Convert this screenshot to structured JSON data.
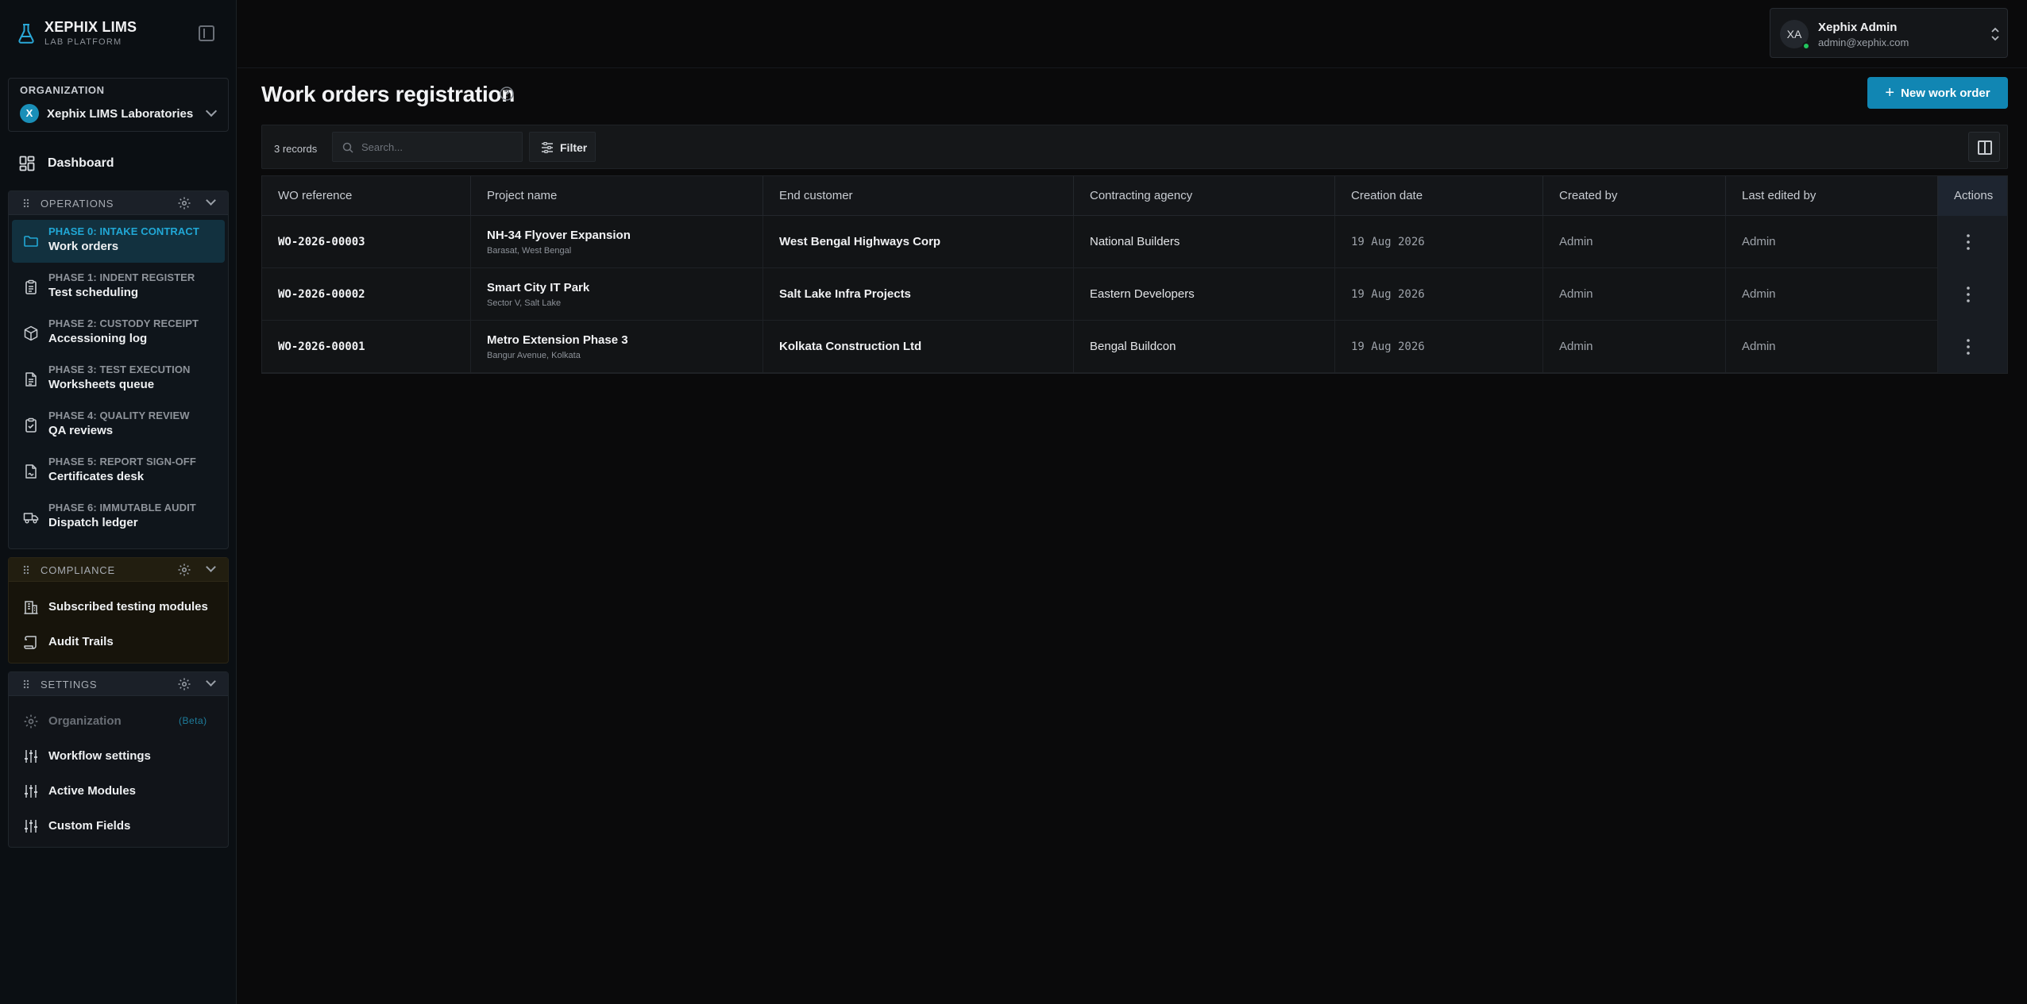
{
  "brand": {
    "title": "XEPHIX LIMS",
    "subtitle": "LAB PLATFORM"
  },
  "organization": {
    "label": "ORGANIZATION",
    "badge": "X",
    "name": "Xephix LIMS Laboratories"
  },
  "dashboard": {
    "label": "Dashboard"
  },
  "sections": {
    "operations": {
      "title": "OPERATIONS",
      "items": [
        {
          "phase": "PHASE 0: INTAKE CONTRACT",
          "label": "Work orders",
          "icon": "folder-icon"
        },
        {
          "phase": "PHASE 1: INDENT REGISTER",
          "label": "Test scheduling",
          "icon": "clipboard-icon"
        },
        {
          "phase": "PHASE 2: CUSTODY RECEIPT",
          "label": "Accessioning log",
          "icon": "package-icon"
        },
        {
          "phase": "PHASE 3: TEST EXECUTION",
          "label": "Worksheets queue",
          "icon": "file-text-icon"
        },
        {
          "phase": "PHASE 4: QUALITY REVIEW",
          "label": "QA reviews",
          "icon": "clipboard-check-icon"
        },
        {
          "phase": "PHASE 5: REPORT SIGN-OFF",
          "label": "Certificates desk",
          "icon": "file-signature-icon"
        },
        {
          "phase": "PHASE 6: IMMUTABLE AUDIT",
          "label": "Dispatch ledger",
          "icon": "truck-icon"
        }
      ]
    },
    "compliance": {
      "title": "COMPLIANCE",
      "items": [
        {
          "label": "Subscribed testing modules",
          "icon": "building-icon"
        },
        {
          "label": "Audit Trails",
          "icon": "scroll-icon"
        }
      ]
    },
    "settings": {
      "title": "SETTINGS",
      "items": [
        {
          "label": "Organization",
          "badge": "(Beta)",
          "icon": "gear-icon"
        },
        {
          "label": "Workflow settings",
          "icon": "sliders-icon"
        },
        {
          "label": "Active Modules",
          "icon": "sliders-icon"
        },
        {
          "label": "Custom Fields",
          "icon": "sliders-icon"
        }
      ]
    }
  },
  "user": {
    "initials": "XA",
    "name": "Xephix Admin",
    "email": "admin@xephix.com"
  },
  "page": {
    "title": "Work orders registration",
    "new_button": "New work order"
  },
  "toolbar": {
    "records": "3 records",
    "search_placeholder": "Search...",
    "filter_label": "Filter"
  },
  "table": {
    "columns": [
      "WO reference",
      "Project name",
      "End customer",
      "Contracting agency",
      "Creation date",
      "Created by",
      "Last edited by",
      "Actions"
    ],
    "rows": [
      {
        "ref": "WO-2026-00003",
        "project": "NH-34 Flyover Expansion",
        "location": "Barasat, West Bengal",
        "customer": "West Bengal Highways Corp",
        "agency": "National Builders",
        "date": "19 Aug 2026",
        "created_by": "Admin",
        "edited_by": "Admin"
      },
      {
        "ref": "WO-2026-00002",
        "project": "Smart City IT Park",
        "location": "Sector V, Salt Lake",
        "customer": "Salt Lake Infra Projects",
        "agency": "Eastern Developers",
        "date": "19 Aug 2026",
        "created_by": "Admin",
        "edited_by": "Admin"
      },
      {
        "ref": "WO-2026-00001",
        "project": "Metro Extension Phase 3",
        "location": "Bangur Avenue, Kolkata",
        "customer": "Kolkata Construction Ltd",
        "agency": "Bengal Buildcon",
        "date": "19 Aug 2026",
        "created_by": "Admin",
        "edited_by": "Admin"
      }
    ]
  },
  "colors": {
    "accent": "#1186b3",
    "active_phase": "#21a8d6",
    "online": "#22c55e"
  }
}
